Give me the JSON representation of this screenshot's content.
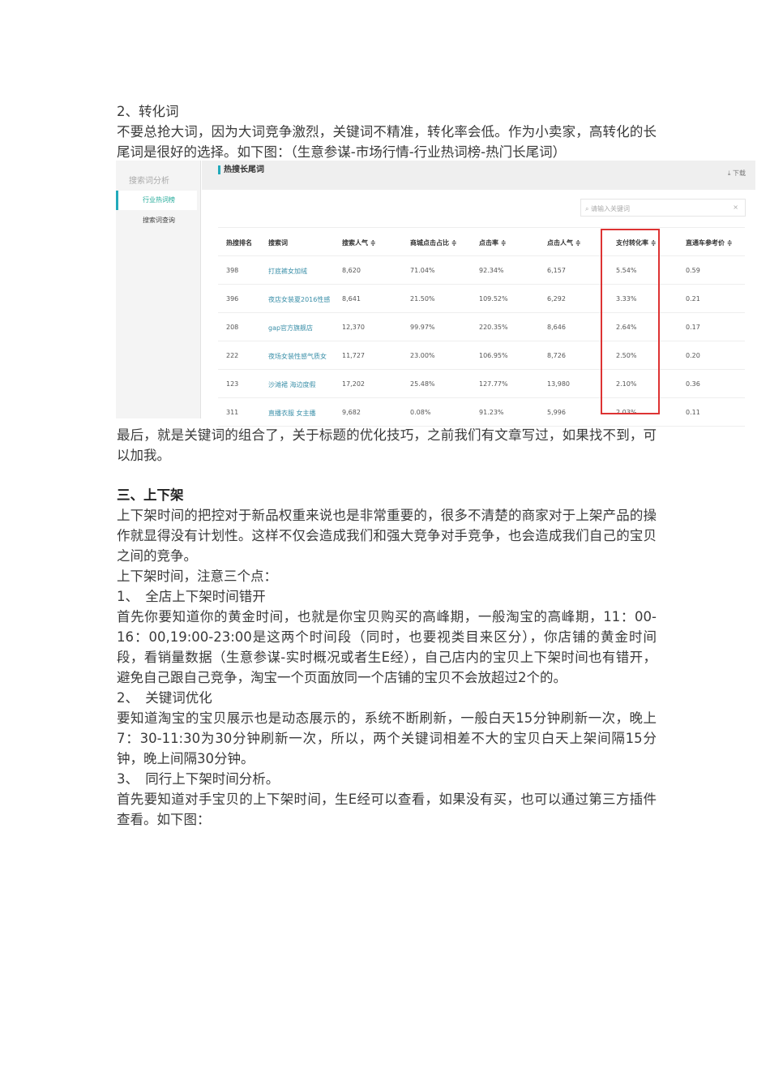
{
  "doc": {
    "h1": "2、转化词",
    "p1": "不要总抢大词，因为大词竞争激烈，关键词不精准，转化率会低。作为小卖家，高转化的长尾词是很好的选择。如下图：（生意参谋-市场行情-行业热词榜-热门长尾词）",
    "p2": "最后，就是关键词的组合了，关于标题的优化技巧，之前我们有文章写过，如果找不到，可以加我。",
    "h2": "三、上下架",
    "p3": "上下架时间的把控对于新品权重来说也是非常重要的，很多不清楚的商家对于上架产品的操作就显得没有计划性。这样不仅会造成我们和强大竞争对手竞争，也会造成我们自己的宝贝之间的竞争。",
    "p4": "上下架时间，注意三个点：",
    "p5": "1、　全店上下架时间错开",
    "p6": "首先你要知道你的黄金时间，也就是你宝贝购买的高峰期，一般淘宝的高峰期，11：00-16：00,19:00-23:00是这两个时间段（同时，也要视类目来区分），你店铺的黄金时间段，看销量数据（生意参谋-实时概况或者生E经），自己店内的宝贝上下架时间也有错开，避免自己跟自己竞争，淘宝一个页面放同一个店铺的宝贝不会放超过2个的。",
    "p7": "2、　关键词优化",
    "p8": "要知道淘宝的宝贝展示也是动态展示的，系统不断刷新，一般白天15分钟刷新一次，晚上7：30-11:30为30分钟刷新一次，所以，两个关键词相差不大的宝贝白天上架间隔15分钟，晚上间隔30分钟。",
    "p9": "3、　同行上下架时间分析。",
    "p10": "首先要知道对手宝贝的上下架时间，生E经可以查看，如果没有买，也可以通过第三方插件查看。如下图："
  },
  "shot": {
    "side_title": "搜索词分析",
    "side_active": "行业热词榜",
    "side_item": "搜索词查询",
    "title": "热搜长尾词",
    "download": "⤓ 下载",
    "search_placeholder": "⌕ 请输入关键词",
    "clear": "×",
    "headers": [
      "热搜排名",
      "搜索词",
      "搜索人气 ≑",
      "商城点击占比 ≑",
      "点击率 ≑",
      "点击人气 ≑",
      "支付转化率 ≑",
      "直通车参考价 ≑"
    ],
    "rows": [
      [
        "398",
        "打底裤女加绒",
        "8,620",
        "71.04%",
        "92.34%",
        "6,157",
        "5.54%",
        "0.59"
      ],
      [
        "396",
        "夜店女装夏2016性感",
        "8,641",
        "21.50%",
        "109.52%",
        "6,292",
        "3.33%",
        "0.21"
      ],
      [
        "208",
        "gap官方旗舰店",
        "12,370",
        "99.97%",
        "220.35%",
        "8,646",
        "2.64%",
        "0.17"
      ],
      [
        "222",
        "夜场女装性感气质女",
        "11,727",
        "23.00%",
        "106.95%",
        "8,726",
        "2.50%",
        "0.20"
      ],
      [
        "123",
        "沙滩裙 海边度假",
        "17,202",
        "25.48%",
        "127.77%",
        "13,980",
        "2.10%",
        "0.36"
      ],
      [
        "311",
        "直播衣服 女主播",
        "9,682",
        "0.08%",
        "91.23%",
        "5,996",
        "2.03%",
        "0.11"
      ]
    ]
  }
}
